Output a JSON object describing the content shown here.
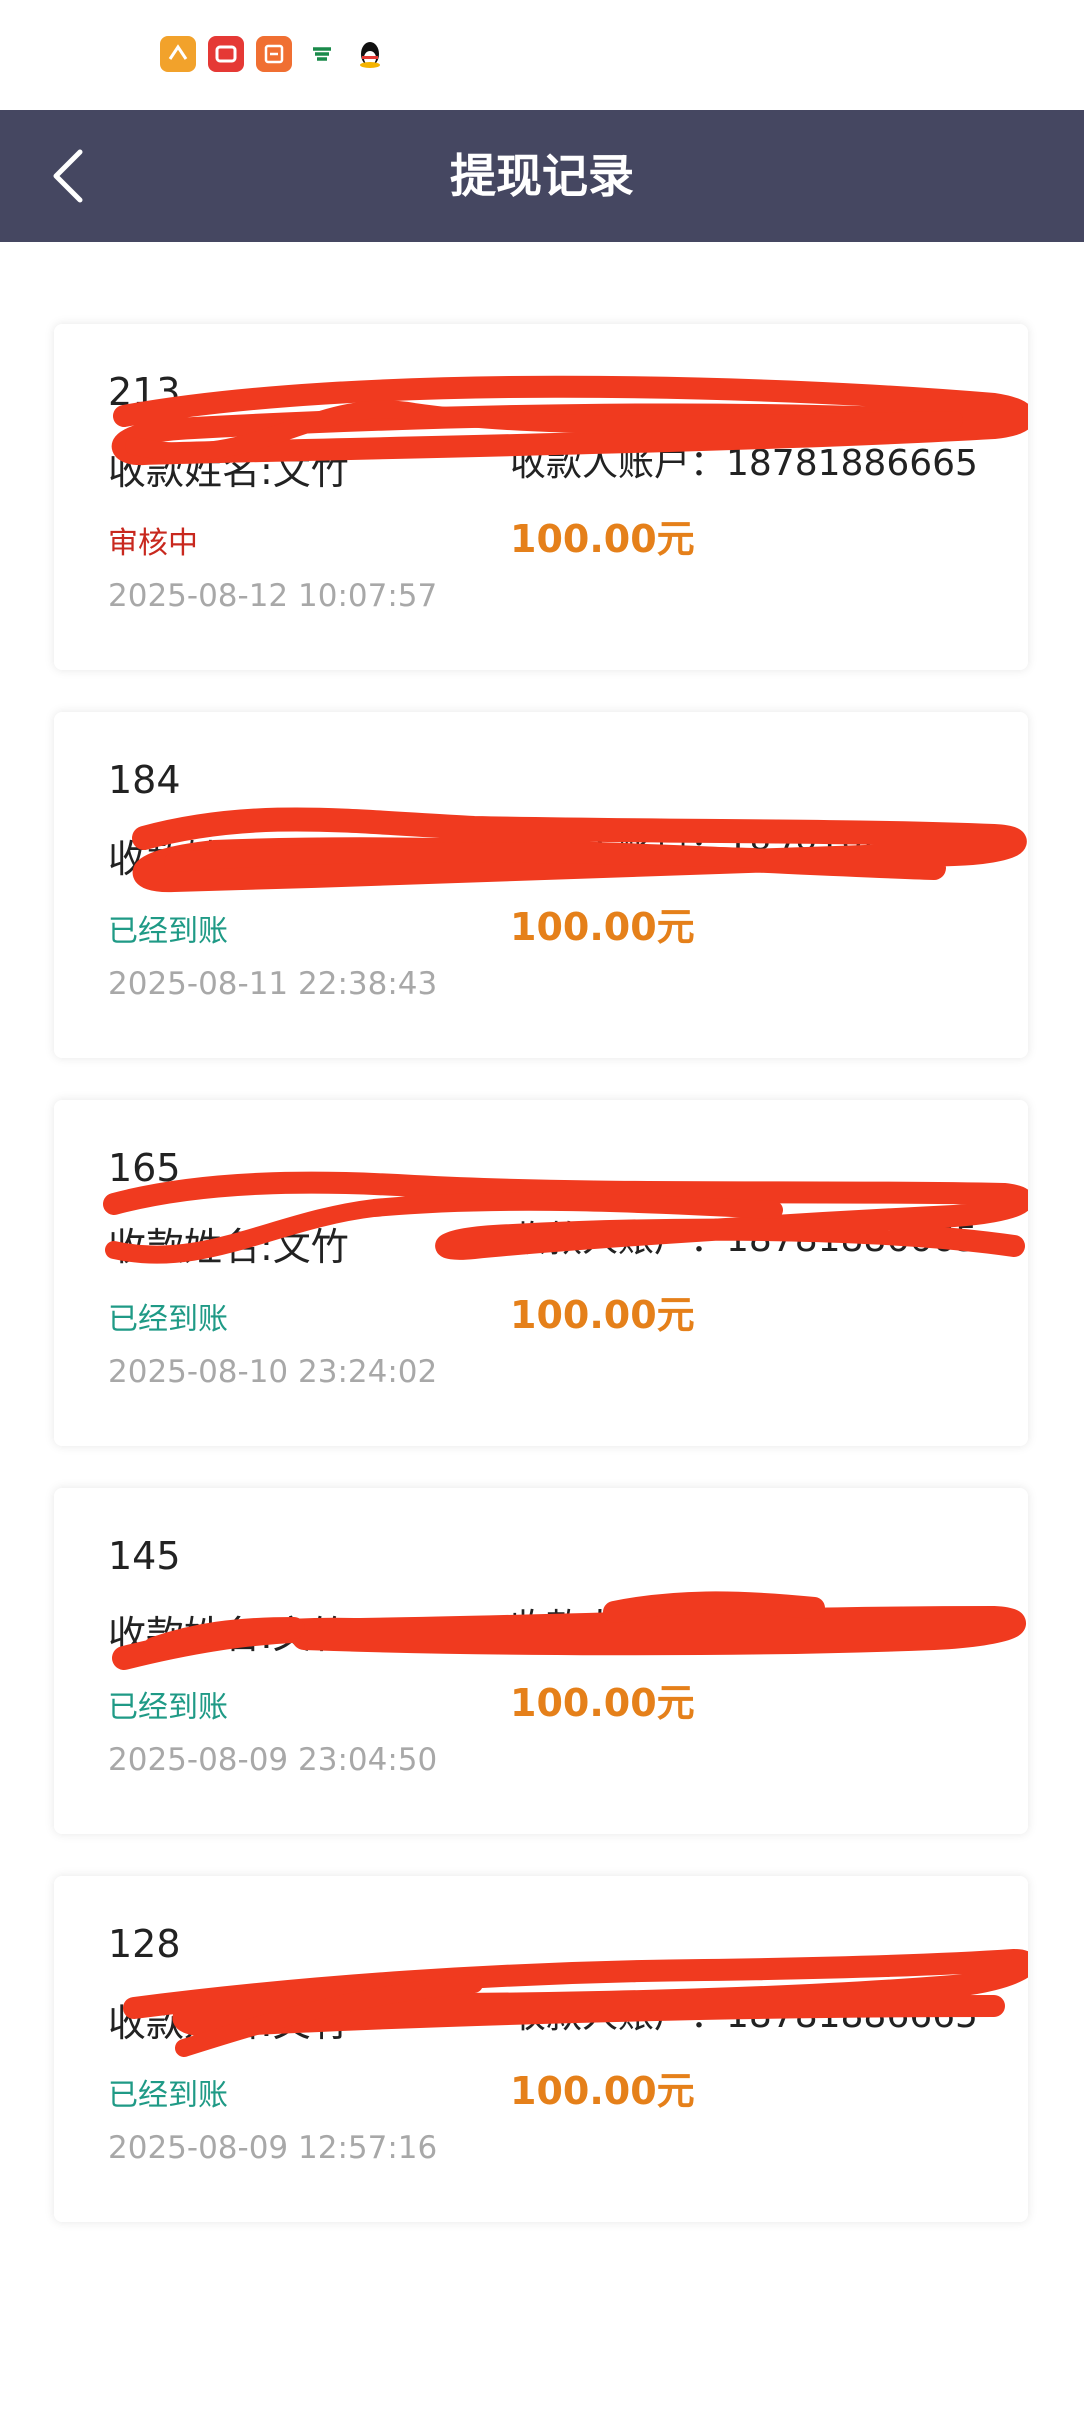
{
  "nav": {
    "title": "提现记录"
  },
  "colors": {
    "nav_bg": "#454761",
    "status_pending": "#c8281e",
    "status_done": "#1f9a86",
    "amount": "#e5801a",
    "scribble": "#f03a1f"
  },
  "records": [
    {
      "id": "213",
      "name": "收款姓名:文竹",
      "account": "收款人账户：18781886665",
      "status": "审核中",
      "status_type": "pending",
      "amount": "100.00元",
      "time": "2025-08-12 10:07:57"
    },
    {
      "id": "184",
      "name": "收款姓名:文竹",
      "account": "收款人账户：18781886665",
      "status": "已经到账",
      "status_type": "done",
      "amount": "100.00元",
      "time": "2025-08-11 22:38:43"
    },
    {
      "id": "165",
      "name": "收款姓名:文竹",
      "account": "收款人账户：18781886665",
      "status": "已经到账",
      "status_type": "done",
      "amount": "100.00元",
      "time": "2025-08-10 23:24:02"
    },
    {
      "id": "145",
      "name": "收款姓名:文竹",
      "account": "收款人账户：18781886665",
      "status": "已经到账",
      "status_type": "done",
      "amount": "100.00元",
      "time": "2025-08-09 23:04:50"
    },
    {
      "id": "128",
      "name": "收款姓名:文竹",
      "account": "收款人账户：18781886665",
      "status": "已经到账",
      "status_type": "done",
      "amount": "100.00元",
      "time": "2025-08-09 12:57:16"
    }
  ]
}
